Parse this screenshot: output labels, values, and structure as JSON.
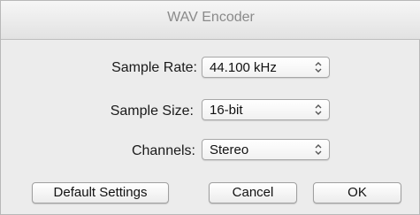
{
  "window": {
    "title": "WAV Encoder"
  },
  "settings": {
    "sample_rate": {
      "label": "Sample Rate:",
      "value": "44.100 kHz"
    },
    "sample_size": {
      "label": "Sample Size:",
      "value": "16-bit"
    },
    "channels": {
      "label": "Channels:",
      "value": "Stereo"
    }
  },
  "buttons": {
    "default_settings": "Default Settings",
    "cancel": "Cancel",
    "ok": "OK"
  },
  "icons": {
    "popup_arrows": "up-down-chevron-icon"
  }
}
